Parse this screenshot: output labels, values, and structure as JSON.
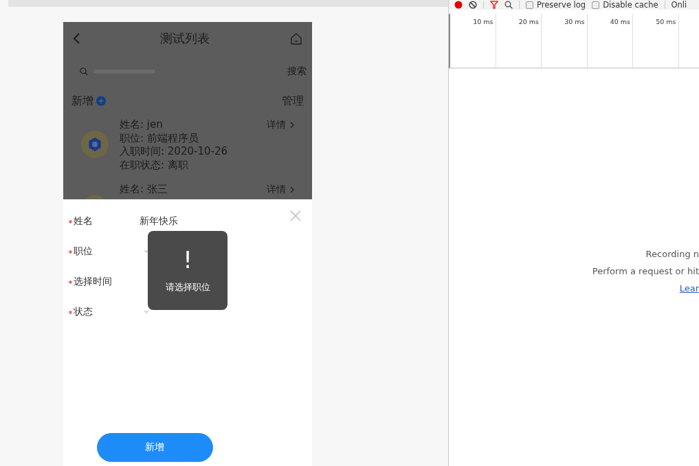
{
  "phone": {
    "title": "测试列表",
    "search": {
      "button": "搜索"
    },
    "add_label": "新增",
    "manage": "管理",
    "records": [
      {
        "lines": [
          "姓名: jen",
          "职位: 前端程序员",
          "入职时间: 2020-10-26",
          "在职状态: 离职"
        ],
        "detail": "详情"
      },
      {
        "lines": [
          "姓名: 张三"
        ],
        "detail": "详情"
      }
    ],
    "form": {
      "fields": [
        {
          "kind": "text",
          "label": "姓名",
          "required": true,
          "value": "新年快乐"
        },
        {
          "kind": "select",
          "label": "职位",
          "required": true
        },
        {
          "kind": "date",
          "label": "选择时间",
          "required": true
        },
        {
          "kind": "select",
          "label": "状态",
          "required": true
        }
      ],
      "submit": "新增"
    },
    "toast": {
      "symbol": "!",
      "message": "请选择职位"
    }
  },
  "devtools": {
    "toolbar": {
      "recording": true,
      "options": [
        {
          "label": "Preserve log",
          "checked": false
        },
        {
          "label": "Disable cache",
          "checked": false
        }
      ],
      "throttle": "Onli"
    },
    "timeline_ticks": [
      "10 ms",
      "20 ms",
      "30 ms",
      "40 ms",
      "50 ms"
    ],
    "empty_state": {
      "lines": [
        "Recording n",
        "Perform a request or hit"
      ],
      "link": "Lear"
    }
  }
}
